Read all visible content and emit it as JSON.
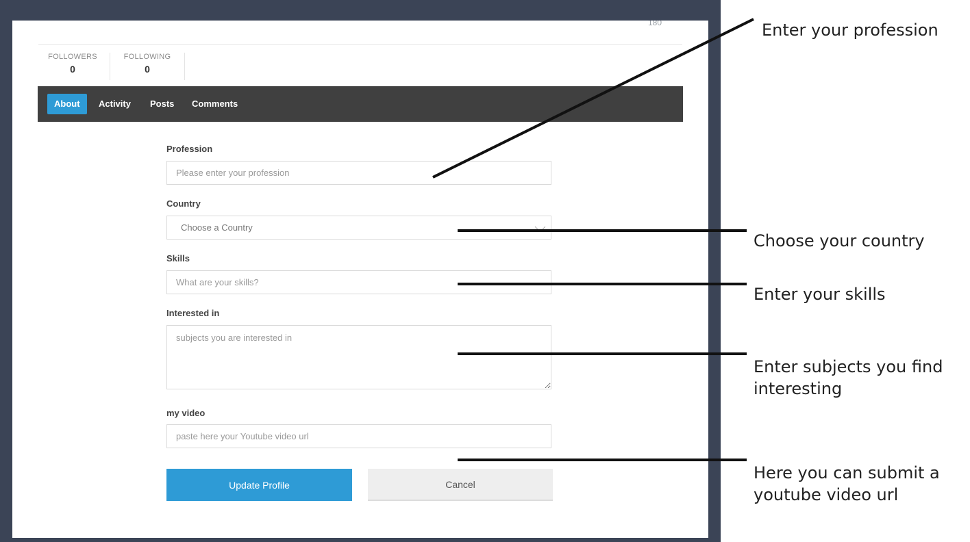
{
  "header": {
    "top_number": "180"
  },
  "stats": {
    "followers": {
      "label": "FOLLOWERS",
      "value": "0"
    },
    "following": {
      "label": "FOLLOWING",
      "value": "0"
    }
  },
  "tabs": [
    {
      "label": "About",
      "active": true
    },
    {
      "label": "Activity",
      "active": false
    },
    {
      "label": "Posts",
      "active": false
    },
    {
      "label": "Comments",
      "active": false
    }
  ],
  "form": {
    "profession": {
      "label": "Profession",
      "placeholder": "Please enter your profession"
    },
    "country": {
      "label": "Country",
      "selected": "Choose a Country"
    },
    "skills": {
      "label": "Skills",
      "placeholder": "What are your skills?"
    },
    "interested": {
      "label": "Interested in",
      "placeholder": "subjects you are interested in"
    },
    "video": {
      "label": "my video",
      "placeholder": "paste here your Youtube video url"
    },
    "update_label": "Update Profile",
    "cancel_label": "Cancel"
  },
  "callouts": {
    "profession": "Enter your profession",
    "country": "Choose your country",
    "skills": "Enter your skills",
    "interests": "Enter subjects you find interesting",
    "video": "Here you can submit a youtube video url"
  },
  "colors": {
    "frame": "#3b4456",
    "tabbar": "#404040",
    "accent": "#2e9bd6",
    "cancel_bg": "#eeeeee"
  }
}
